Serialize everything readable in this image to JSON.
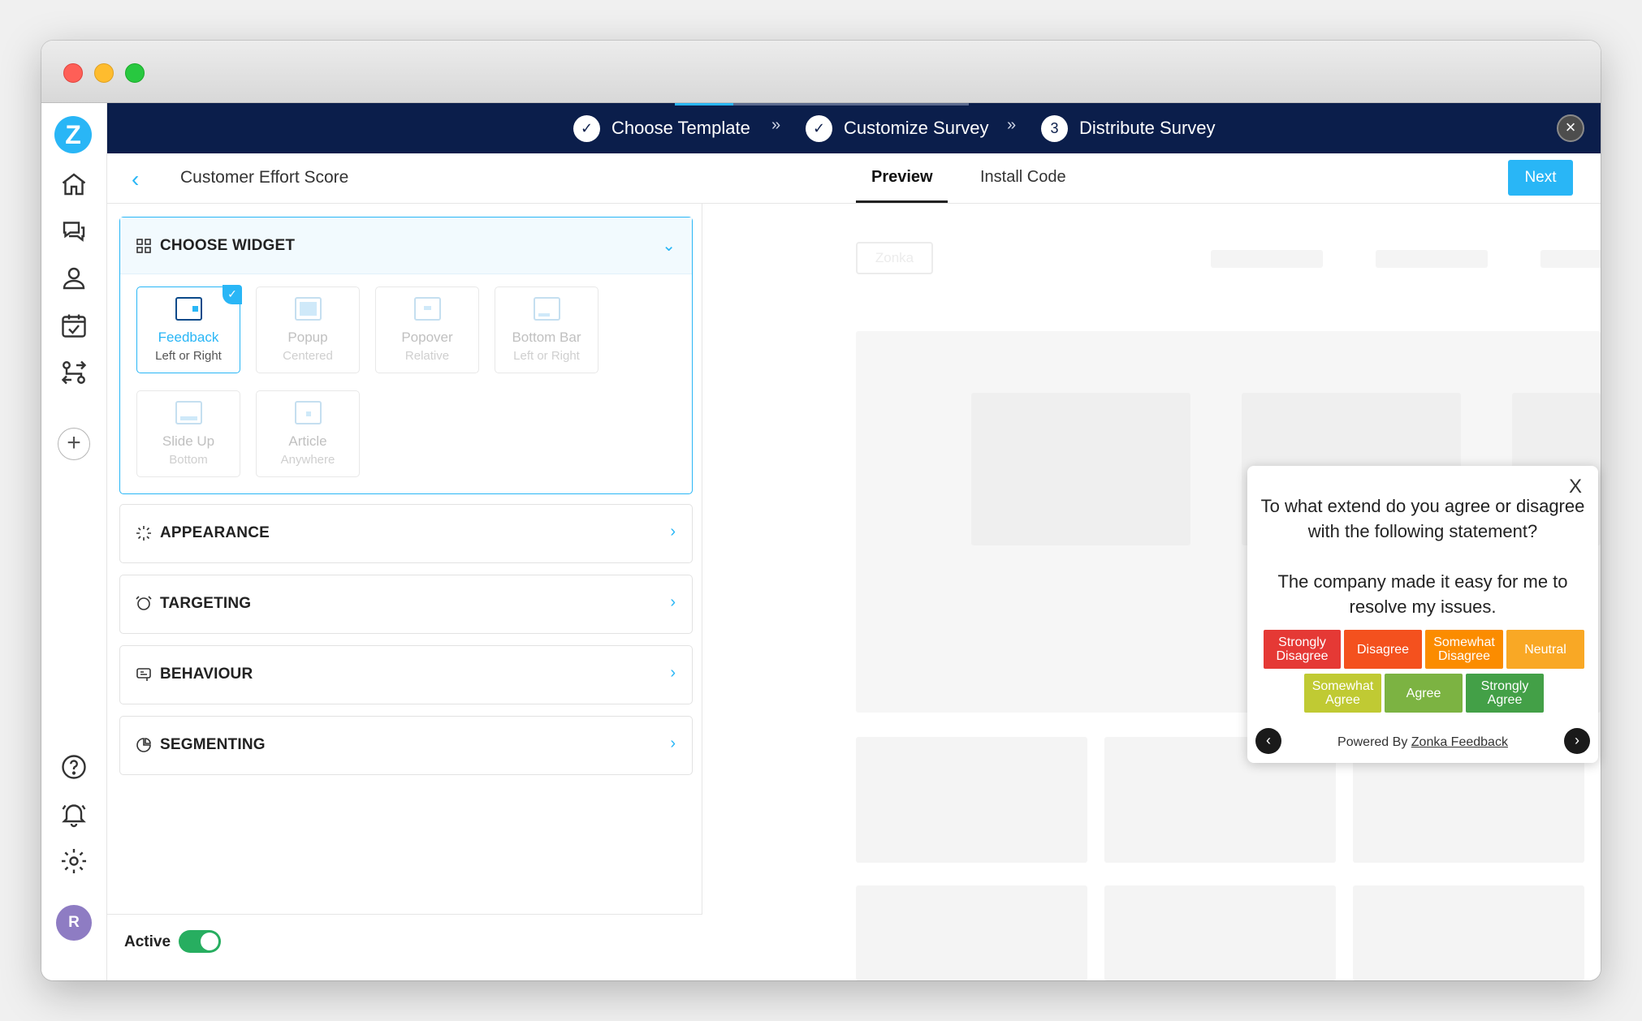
{
  "steps": {
    "s1": "Choose Template",
    "s2": "Customize Survey",
    "s3": "Distribute Survey",
    "s3num": "3",
    "sep": "»"
  },
  "header": {
    "back": "‹",
    "title": "Customer Effort Score",
    "tab_preview": "Preview",
    "tab_install": "Install Code",
    "next": "Next",
    "close": "×"
  },
  "rail": {
    "logo": "Z",
    "plus": "+",
    "avatar": "R"
  },
  "panel": {
    "choose_widget": "CHOOSE WIDGET",
    "appearance": "APPEARANCE",
    "targeting": "TARGETING",
    "behaviour": "BEHAVIOUR",
    "segmenting": "SEGMENTING",
    "widgets": [
      {
        "name": "Feedback",
        "desc": "Left or Right"
      },
      {
        "name": "Popup",
        "desc": "Centered"
      },
      {
        "name": "Popover",
        "desc": "Relative"
      },
      {
        "name": "Bottom Bar",
        "desc": "Left or Right"
      },
      {
        "name": "Slide Up",
        "desc": "Bottom"
      },
      {
        "name": "Article",
        "desc": "Anywhere"
      }
    ],
    "active_label": "Active"
  },
  "preview": {
    "placeholder_button": "Zonka"
  },
  "survey": {
    "close": "X",
    "question1": "To what extend do you agree or disagree with the following statement?",
    "question2": "The company made it easy for me to resolve my issues.",
    "options": [
      {
        "label": "Strongly Disagree",
        "color": "#e53935"
      },
      {
        "label": "Disagree",
        "color": "#f4511e"
      },
      {
        "label": "Somewhat Disagree",
        "color": "#fb8c00"
      },
      {
        "label": "Neutral",
        "color": "#f9a825"
      },
      {
        "label": "Somewhat Agree",
        "color": "#c0ca33"
      },
      {
        "label": "Agree",
        "color": "#7cb342"
      },
      {
        "label": "Strongly Agree",
        "color": "#43a047"
      }
    ],
    "powered_by": "Powered By",
    "powered_link": "Zonka Feedback",
    "prev": "‹",
    "next": "›"
  },
  "colors": {
    "accent": "#29b6f6",
    "navy": "#0b1e4b",
    "active_toggle": "#27ae60"
  }
}
